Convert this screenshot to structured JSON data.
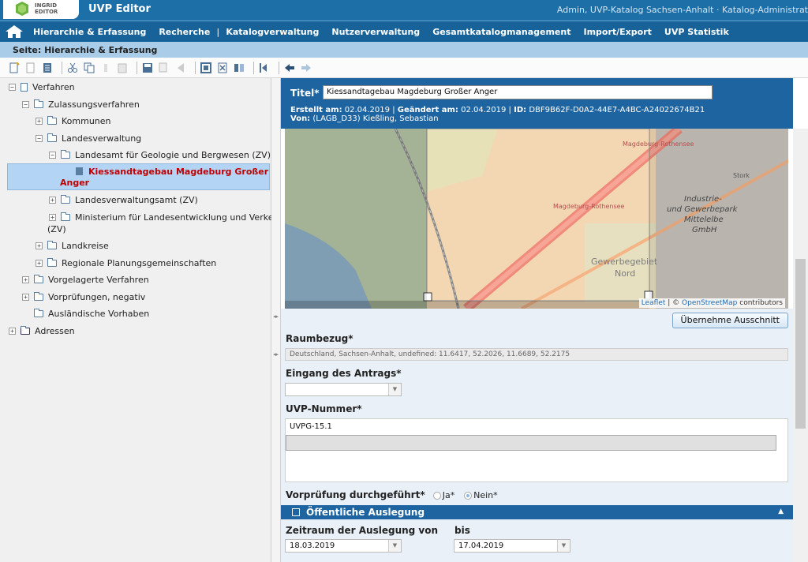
{
  "header": {
    "logo_text_line1": "INGRID",
    "logo_text_line2": "EDITOR",
    "app_title": "UVP Editor",
    "user_info": "Admin, UVP-Katalog Sachsen-Anhalt · Katalog-Administrat"
  },
  "nav": {
    "items": [
      "Hierarchie & Erfassung",
      "Recherche",
      "|",
      "Katalogverwaltung",
      "Nutzerverwaltung",
      "Gesamtkatalogmanagement",
      "Import/Export",
      "UVP Statistik"
    ]
  },
  "subbar": {
    "title": "Seite: Hierarchie & Erfassung"
  },
  "tree": {
    "items": [
      "Verfahren",
      "Zulassungsverfahren",
      "Kommunen",
      "Landesverwaltung",
      "Landesamt für Geologie und Bergwesen (ZV)",
      "Kiessandtagebau Magdeburg Großer",
      "Anger",
      "Landesverwaltungsamt (ZV)",
      "Ministerium für Landesentwicklung und Verkehr",
      "(ZV)",
      "Landkreise",
      "Regionale Planungsgemeinschaften",
      "Vorgelagerte Verfahren",
      "Vorprüfungen, negativ",
      "Ausländische Vorhaben",
      "Adressen"
    ]
  },
  "record": {
    "title_label": "Titel*",
    "title_value": "Kiessandtagebau Magdeburg Großer Anger",
    "created_label": "Erstellt am:",
    "created_value": "02.04.2019",
    "changed_label": "Geändert am:",
    "changed_value": "02.04.2019",
    "id_label": "ID:",
    "id_value": "DBF9B62F-D0A2-44E7-A4BC-A24022674B21",
    "by_label": "Von:",
    "by_value": "(LAGB_D33) Kießling, Sebastian"
  },
  "map": {
    "labels": [
      "Magdeburg-Rothensee",
      "Magdeburg-Rothensee",
      "Stork",
      "Industrie-",
      "und Gewerbepark",
      "Mittelelbe",
      "GmbH",
      "Gewerbegebiet",
      "Nord"
    ],
    "credit_leaflet": "Leaflet",
    "credit_sep": " | © ",
    "credit_osm": "OpenStreetMap",
    "credit_contrib": " contributors"
  },
  "form": {
    "apply_button": "Übernehme Ausschnitt",
    "raumbezug_label": "Raumbezug*",
    "raumbezug_value": "Deutschland, Sachsen-Anhalt, undefined: 11.6417, 52.2026, 11.6689, 52.2175",
    "eingang_label": "Eingang des Antrags*",
    "eingang_value": "",
    "uvp_label": "UVP-Nummer*",
    "uvp_value": "UVPG-15.1",
    "vorpruefung_label": "Vorprüfung durchgeführt*",
    "radio_ja": "Ja*",
    "radio_nein": "Nein*",
    "section_title": "Öffentliche Auslegung",
    "zeitraum_label": "Zeitraum der Auslegung von",
    "bis_label": "bis",
    "von_value": "18.03.2019",
    "bis_value": "17.04.2019"
  },
  "colors": {
    "header_blue": "#1d6fa8",
    "nav_blue": "#166299",
    "subbar": "#a9cde9",
    "selected_text": "#c00000"
  }
}
